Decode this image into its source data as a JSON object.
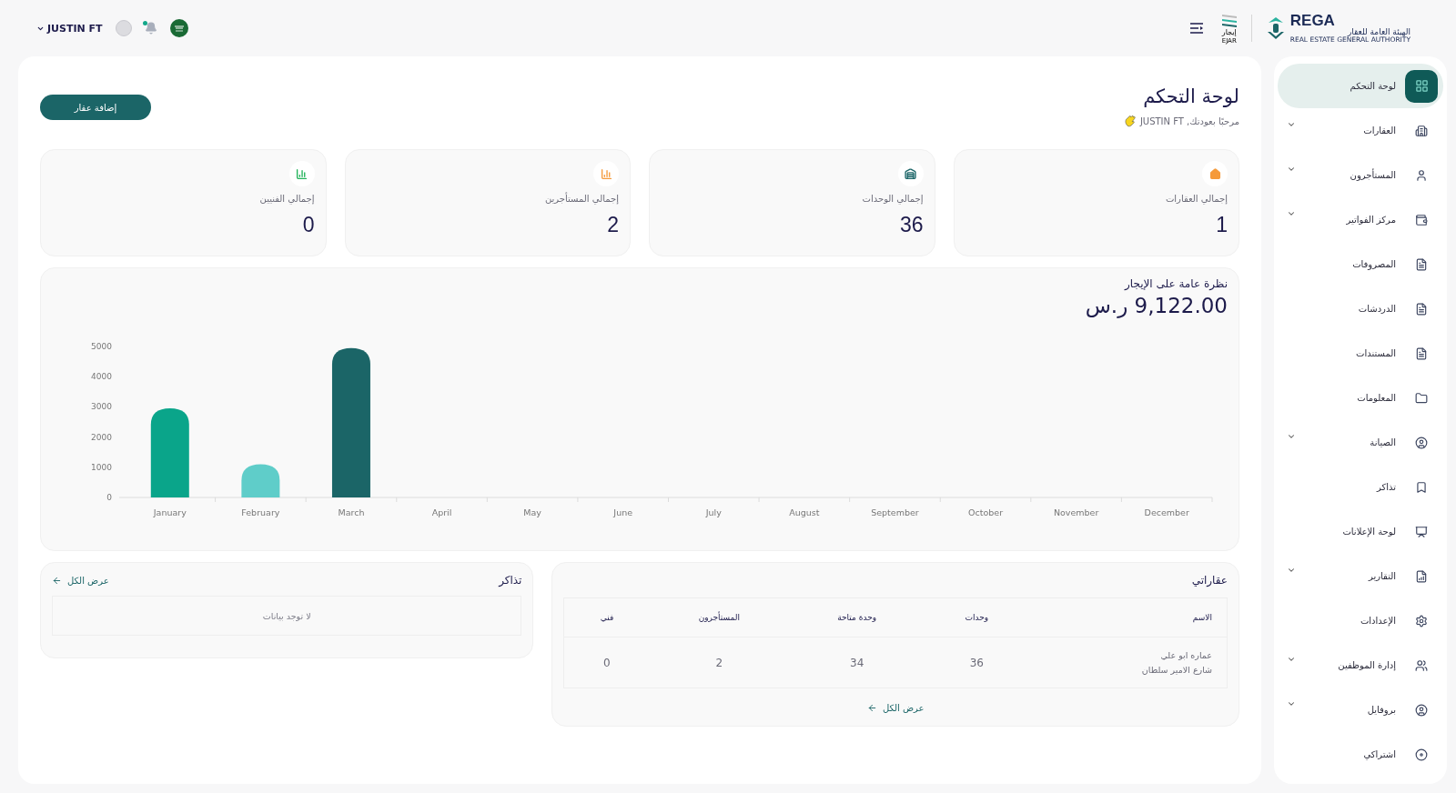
{
  "header": {
    "user_name": "JUSTIN FT",
    "logos": {
      "rega": "REGA",
      "rega_ar": "الهيئة العامة للعقار",
      "rega_en": "REAL ESTATE GENERAL AUTHORITY",
      "ejar_ar": "إيجار",
      "ejar_en": "EJAR"
    }
  },
  "sidebar": {
    "items": [
      {
        "label": "لوحة التحكم",
        "selected": true,
        "has_submenu": false
      },
      {
        "label": "العقارات",
        "selected": false,
        "has_submenu": true
      },
      {
        "label": "المستأجرون",
        "selected": false,
        "has_submenu": true
      },
      {
        "label": "مركز الفواتير",
        "selected": false,
        "has_submenu": true
      },
      {
        "label": "المصروفات",
        "selected": false,
        "has_submenu": false
      },
      {
        "label": "الدردشات",
        "selected": false,
        "has_submenu": false
      },
      {
        "label": "المستندات",
        "selected": false,
        "has_submenu": false
      },
      {
        "label": "المعلومات",
        "selected": false,
        "has_submenu": false
      },
      {
        "label": "الصيانة",
        "selected": false,
        "has_submenu": true
      },
      {
        "label": "تذاكر",
        "selected": false,
        "has_submenu": false
      },
      {
        "label": "لوحة الإعلانات",
        "selected": false,
        "has_submenu": false
      },
      {
        "label": "التقارير",
        "selected": false,
        "has_submenu": true
      },
      {
        "label": "الإعدادات",
        "selected": false,
        "has_submenu": false
      },
      {
        "label": "إدارة الموظفين",
        "selected": false,
        "has_submenu": true
      },
      {
        "label": "بروفايل",
        "selected": false,
        "has_submenu": true
      },
      {
        "label": "اشتراكي",
        "selected": false,
        "has_submenu": false
      }
    ]
  },
  "page": {
    "title": "لوحة التحكم",
    "welcome": "مرحبًا بعودتك, JUSTIN FT",
    "add_button": "إضافة عقار"
  },
  "stats": [
    {
      "label": "إجمالي العقارات",
      "value": "1"
    },
    {
      "label": "إجمالي الوحدات",
      "value": "36"
    },
    {
      "label": "إجمالي المستأجرين",
      "value": "2"
    },
    {
      "label": "إجمالي الفنيين",
      "value": "0"
    }
  ],
  "rent_overview": {
    "title": "نظرة عامة على الإيجار",
    "amount": "9,122.00 ر.س",
    "chart_data": {
      "type": "bar",
      "categories": [
        "January",
        "February",
        "March",
        "April",
        "May",
        "June",
        "July",
        "August",
        "September",
        "October",
        "November",
        "December"
      ],
      "series": [
        {
          "color": "#0aa58a",
          "values": [
            2950,
            null,
            null,
            null,
            null,
            null,
            null,
            null,
            null,
            null,
            null,
            null
          ]
        },
        {
          "color": "#5fcdc9",
          "values": [
            null,
            1100,
            null,
            null,
            null,
            null,
            null,
            null,
            null,
            null,
            null,
            null
          ]
        },
        {
          "color": "#1b6567",
          "values": [
            null,
            null,
            4950,
            null,
            null,
            null,
            null,
            null,
            null,
            null,
            null,
            null
          ]
        }
      ],
      "ylim": [
        0,
        5000
      ],
      "yticks": [
        0,
        1000,
        2000,
        3000,
        4000,
        5000
      ]
    }
  },
  "properties": {
    "title": "عقاراتي",
    "columns": [
      "الاسم",
      "وحدات",
      "وحدة متاحة",
      "المستأجرون",
      "فني"
    ],
    "rows": [
      {
        "name": "عماره ابو علي",
        "address": "شارع الامير سلطان",
        "units": "36",
        "available": "34",
        "tenants": "2",
        "technicians": "0"
      }
    ],
    "view_all": "عرض الكل"
  },
  "tickets": {
    "title": "تذاكر",
    "view_all": "عرض الكل",
    "empty": "لا توجد بيانات"
  }
}
